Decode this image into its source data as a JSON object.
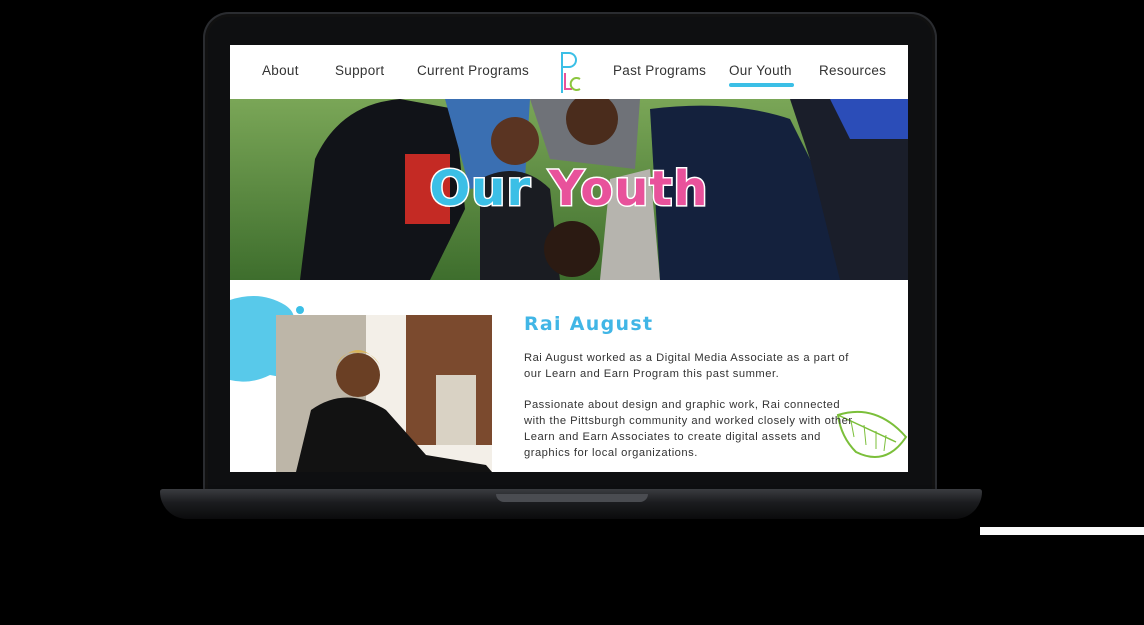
{
  "nav": {
    "left_items": [
      "About",
      "Support",
      "Current Programs"
    ],
    "right_items": [
      "Past Programs",
      "Our Youth",
      "Resources"
    ],
    "active": "Our Youth"
  },
  "logo": {
    "letters": "PLC",
    "colors": [
      "#3bbfe6",
      "#e8529b",
      "#8cc63f"
    ]
  },
  "hero": {
    "title_part1": "Our",
    "title_part2": "Youth",
    "title_colors": [
      "#3bbfe6",
      "#e8529b"
    ]
  },
  "profile": {
    "name": "Rai August",
    "paragraph1": "Rai August worked as a Digital Media Associate as a part of our Learn and Earn Program this past summer.",
    "paragraph2": "Passionate about design and graphic work, Rai connected with the Pittsburgh community and worked closely with other Learn and Earn Associates to create digital assets and graphics for local organizations."
  },
  "colors": {
    "accent_blue": "#3bbfe6",
    "accent_pink": "#e8529b",
    "accent_green": "#8cc63f"
  }
}
